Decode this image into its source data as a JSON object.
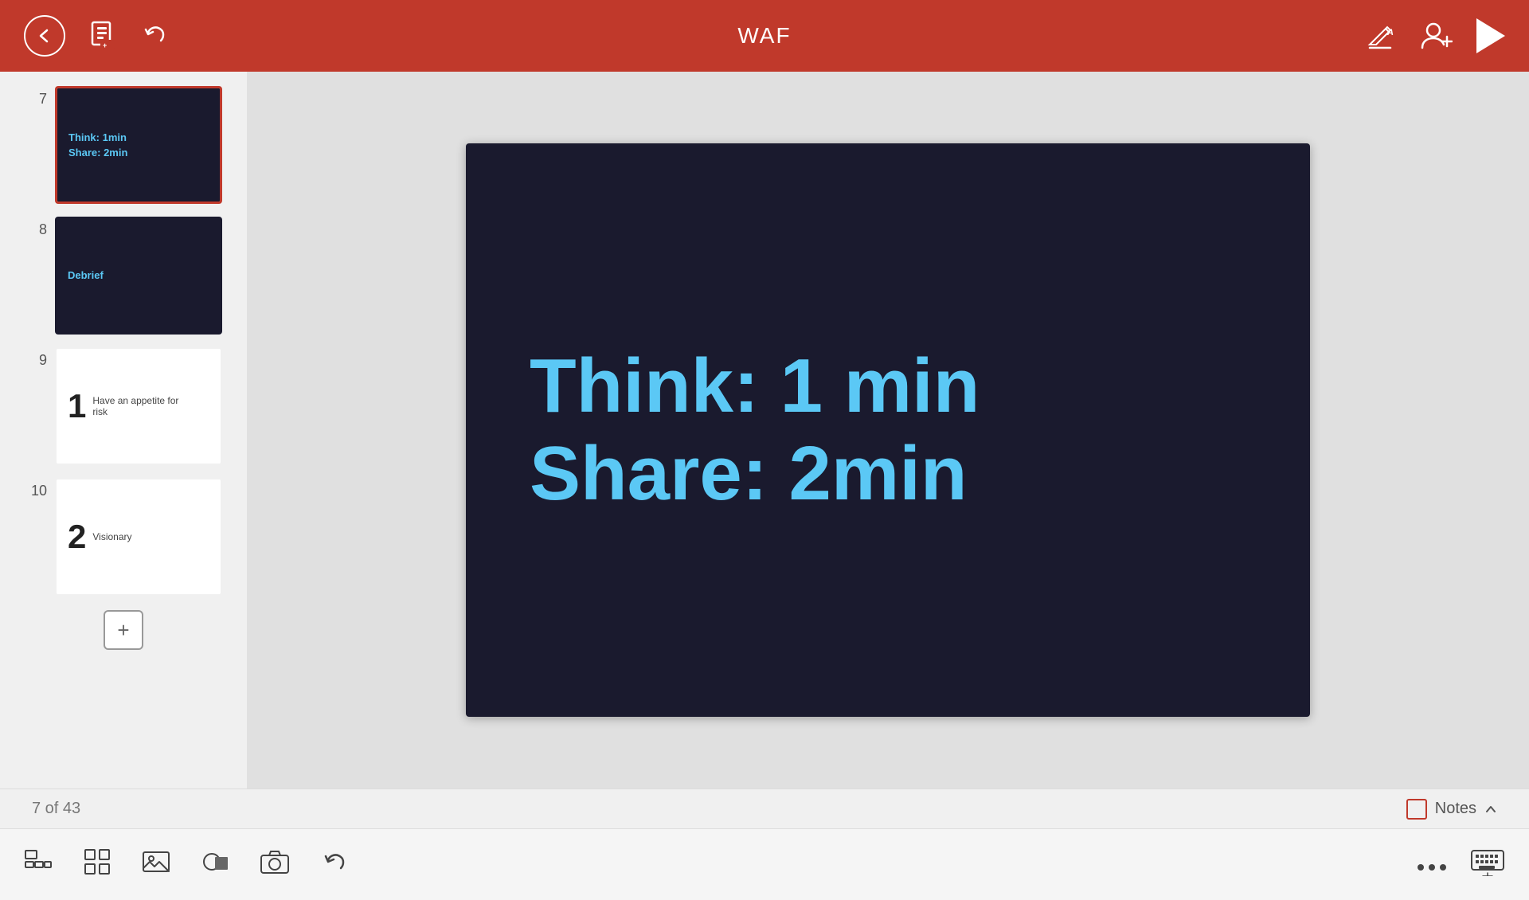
{
  "header": {
    "title": "WAF",
    "back_label": "←",
    "document_icon": "document",
    "undo_label": "↩",
    "annotate_icon": "annotate",
    "add_user_icon": "add-user",
    "play_icon": "play"
  },
  "sidebar": {
    "slides": [
      {
        "number": "7",
        "type": "dark",
        "active": true,
        "lines": [
          "Think: 1min",
          "Share: 2min"
        ],
        "label": ""
      },
      {
        "number": "8",
        "type": "dark",
        "active": false,
        "lines": [
          "Debrief"
        ],
        "label": ""
      },
      {
        "number": "9",
        "type": "white",
        "active": false,
        "num": "1",
        "label": "Have an appetite for risk"
      },
      {
        "number": "10",
        "type": "white",
        "active": false,
        "num": "2",
        "label": "Visionary"
      }
    ],
    "add_button_label": "+"
  },
  "slide_view": {
    "line1": "Think: 1 min",
    "line2": "Share: 2min"
  },
  "status": {
    "page_indicator": "7 of 43",
    "notes_label": "Notes"
  },
  "bottom_toolbar": {
    "icons": [
      "outline-view",
      "grid-view",
      "image-view",
      "shape-tool",
      "camera",
      "undo"
    ],
    "right_icons": [
      "more",
      "keyboard"
    ]
  }
}
